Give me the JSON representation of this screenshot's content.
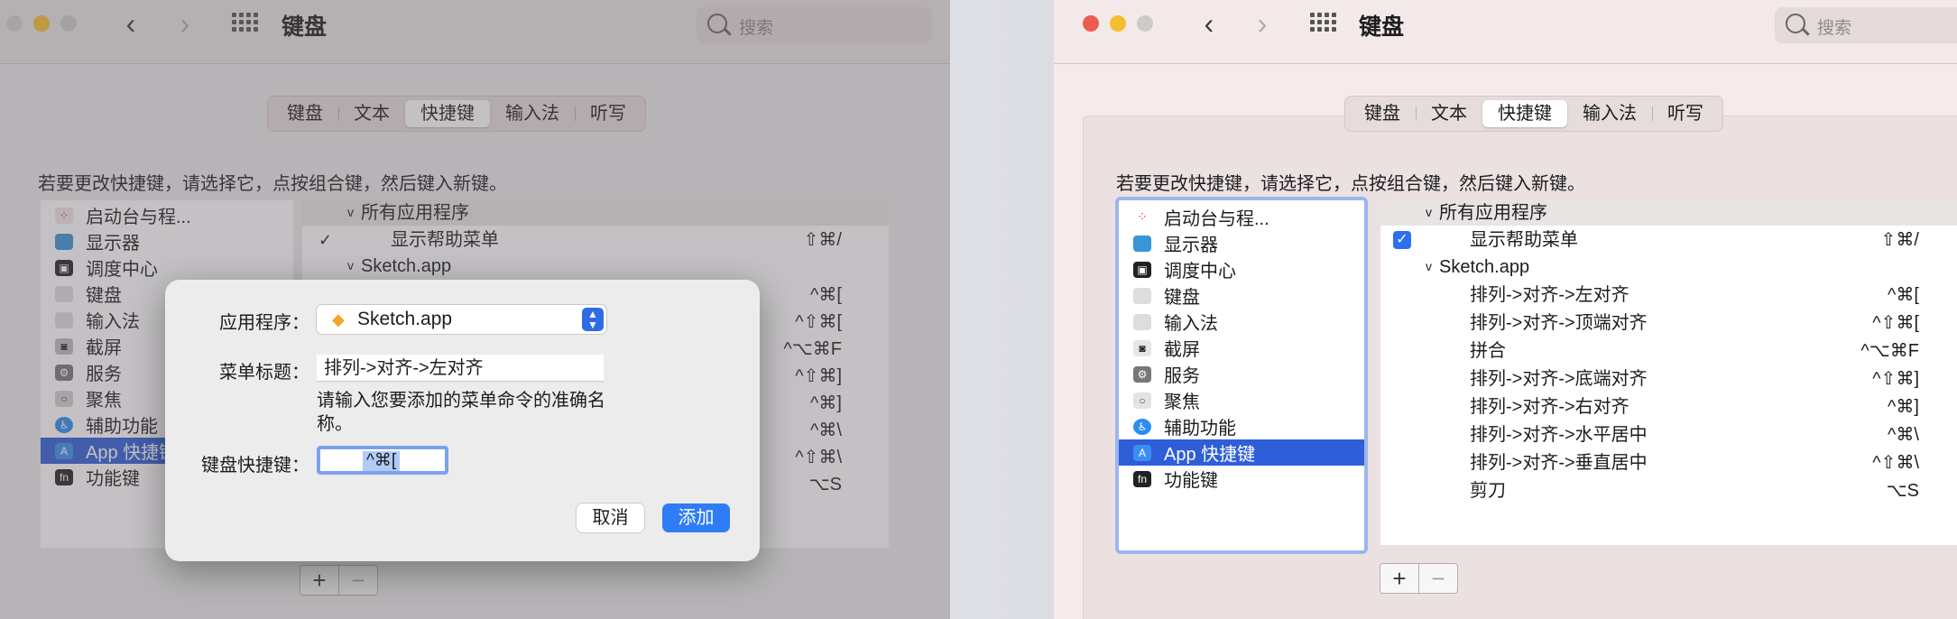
{
  "window": {
    "title": "键盘",
    "search_placeholder": "搜索"
  },
  "tabs": [
    "键盘",
    "文本",
    "快捷键",
    "输入法",
    "听写"
  ],
  "active_tab": "快捷键",
  "hint": "若要更改快捷键，请选择它，点按组合键，然后键入新键。",
  "sidebar": {
    "items": [
      {
        "label": "启动台与程...",
        "icon": "launchpad-icon"
      },
      {
        "label": "显示器",
        "icon": "display-icon"
      },
      {
        "label": "调度中心",
        "icon": "mission-control-icon"
      },
      {
        "label": "键盘",
        "icon": "keyboard-icon"
      },
      {
        "label": "输入法",
        "icon": "input-source-icon"
      },
      {
        "label": "截屏",
        "icon": "screenshot-icon"
      },
      {
        "label": "服务",
        "icon": "gear-icon"
      },
      {
        "label": "聚焦",
        "icon": "spotlight-icon"
      },
      {
        "label": "辅助功能",
        "icon": "accessibility-icon"
      },
      {
        "label": "App 快捷键",
        "icon": "app-store-icon"
      },
      {
        "label": "功能键",
        "icon": "fn-key-icon"
      }
    ],
    "selected": "App 快捷键"
  },
  "shortcuts": {
    "all_apps_group": "所有应用程序",
    "help_menu": {
      "label": "显示帮助菜单",
      "key": "⇧⌘/"
    },
    "sketch_group": "Sketch.app",
    "sketch_items": [
      {
        "label": "排列->对齐->左对齐",
        "key": "^⌘["
      },
      {
        "label": "排列->对齐->顶端对齐",
        "key": "^⇧⌘["
      },
      {
        "label": "拼合",
        "key": "^⌥⌘F"
      },
      {
        "label": "排列->对齐->底端对齐",
        "key": "^⇧⌘]"
      },
      {
        "label": "排列->对齐->右对齐",
        "key": "^⌘]"
      },
      {
        "label": "排列->对齐->水平居中",
        "key": "^⌘\\"
      },
      {
        "label": "排列->对齐->垂直居中",
        "key": "^⇧⌘\\"
      },
      {
        "label": "剪刀",
        "key": "⌥S"
      }
    ]
  },
  "buttons": {
    "plus": "+",
    "minus": "−"
  },
  "dialog": {
    "app_label": "应用程序：",
    "app_value": "Sketch.app",
    "menu_title_label": "菜单标题：",
    "menu_title_value": "排列->对齐->左对齐",
    "help_text": "请输入您要添加的菜单命令的准确名称。",
    "shortcut_label": "键盘快捷键：",
    "shortcut_value": "^⌘[",
    "cancel": "取消",
    "add": "添加"
  },
  "colors": {
    "accent": "#2f7cf6",
    "selection": "#2e5ed8",
    "traffic_red": "#ee5b52",
    "traffic_yellow": "#f5be31",
    "traffic_gray": "#cfcaca"
  }
}
